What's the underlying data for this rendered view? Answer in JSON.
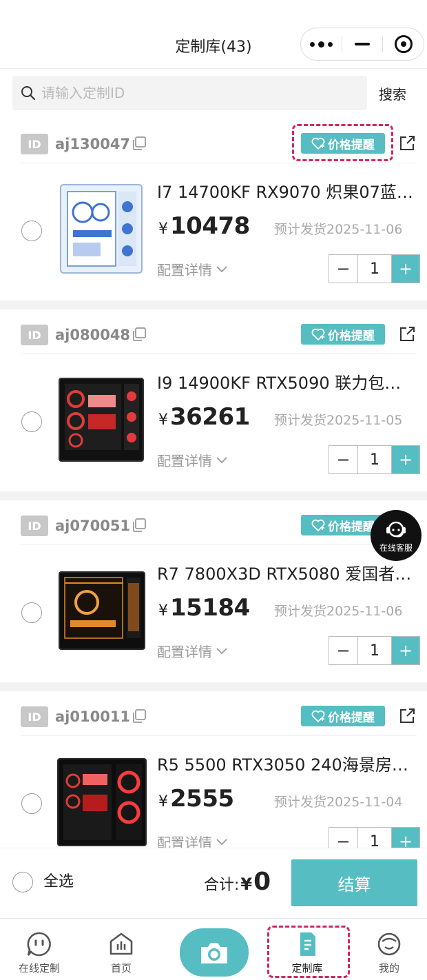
{
  "header": {
    "title": "定制库(43)"
  },
  "search": {
    "placeholder": "请输入定制ID",
    "button_label": "搜索"
  },
  "items": [
    {
      "id_badge": "ID",
      "id": "aj130047",
      "price_alert": "价格提醒",
      "name": "I7 14700KF RX9070 炽果07蓝…",
      "currency": "¥",
      "price": "10478",
      "ship": "预计发货2025-11-06",
      "detail": "配置详情",
      "qty": "1",
      "theme": "white"
    },
    {
      "id_badge": "ID",
      "id": "aj080048",
      "price_alert": "价格提醒",
      "name": "I9 14900KF RTX5090 联力包…",
      "currency": "¥",
      "price": "36261",
      "ship": "预计发货2025-11-05",
      "detail": "配置详情",
      "qty": "1",
      "theme": "red"
    },
    {
      "id_badge": "ID",
      "id": "aj070051",
      "price_alert": "价格提醒",
      "name": "R7 7800X3D RTX5080 爱国者…",
      "currency": "¥",
      "price": "15184",
      "ship": "预计发货2025-11-06",
      "detail": "配置详情",
      "qty": "1",
      "theme": "orange"
    },
    {
      "id_badge": "ID",
      "id": "aj010011",
      "price_alert": "价格提醒",
      "name": "R5 5500 RTX3050 240海景房…",
      "currency": "¥",
      "price": "2555",
      "ship": "预计发货2025-11-04",
      "detail": "配置详情",
      "qty": "1",
      "theme": "red"
    }
  ],
  "service": {
    "label": "在线客服"
  },
  "footer": {
    "select_all": "全选",
    "total_label": "合计:",
    "currency": "¥",
    "total": "0",
    "checkout": "结算"
  },
  "tabs": [
    {
      "label": "在线定制",
      "icon": "face-bubble-icon"
    },
    {
      "label": "首页",
      "icon": "home-icon"
    },
    {
      "label": "",
      "icon": "camera-icon"
    },
    {
      "label": "定制库",
      "icon": "library-icon",
      "active": true
    },
    {
      "label": "我的",
      "icon": "profile-icon"
    }
  ],
  "colors": {
    "accent": "#56bec3",
    "highlight": "#d02560"
  }
}
